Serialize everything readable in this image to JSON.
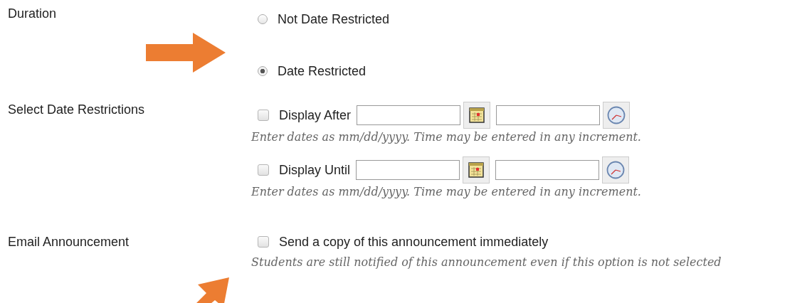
{
  "duration": {
    "label": "Duration",
    "options": [
      {
        "label": "Not Date Restricted",
        "selected": false
      },
      {
        "label": "Date Restricted",
        "selected": true
      }
    ]
  },
  "date_restrictions": {
    "label": "Select Date Restrictions",
    "rows": [
      {
        "label": "Display After",
        "checked": false,
        "hint": "Enter dates as mm/dd/yyyy. Time may be entered in any increment."
      },
      {
        "label": "Display Until",
        "checked": false,
        "hint": "Enter dates as mm/dd/yyyy. Time may be entered in any increment."
      }
    ]
  },
  "email": {
    "label": "Email Announcement",
    "checkbox": {
      "label": "Send a copy of this announcement immediately",
      "checked": false
    },
    "hint": "Students are still notified of this announcement even if this option is not selected"
  }
}
